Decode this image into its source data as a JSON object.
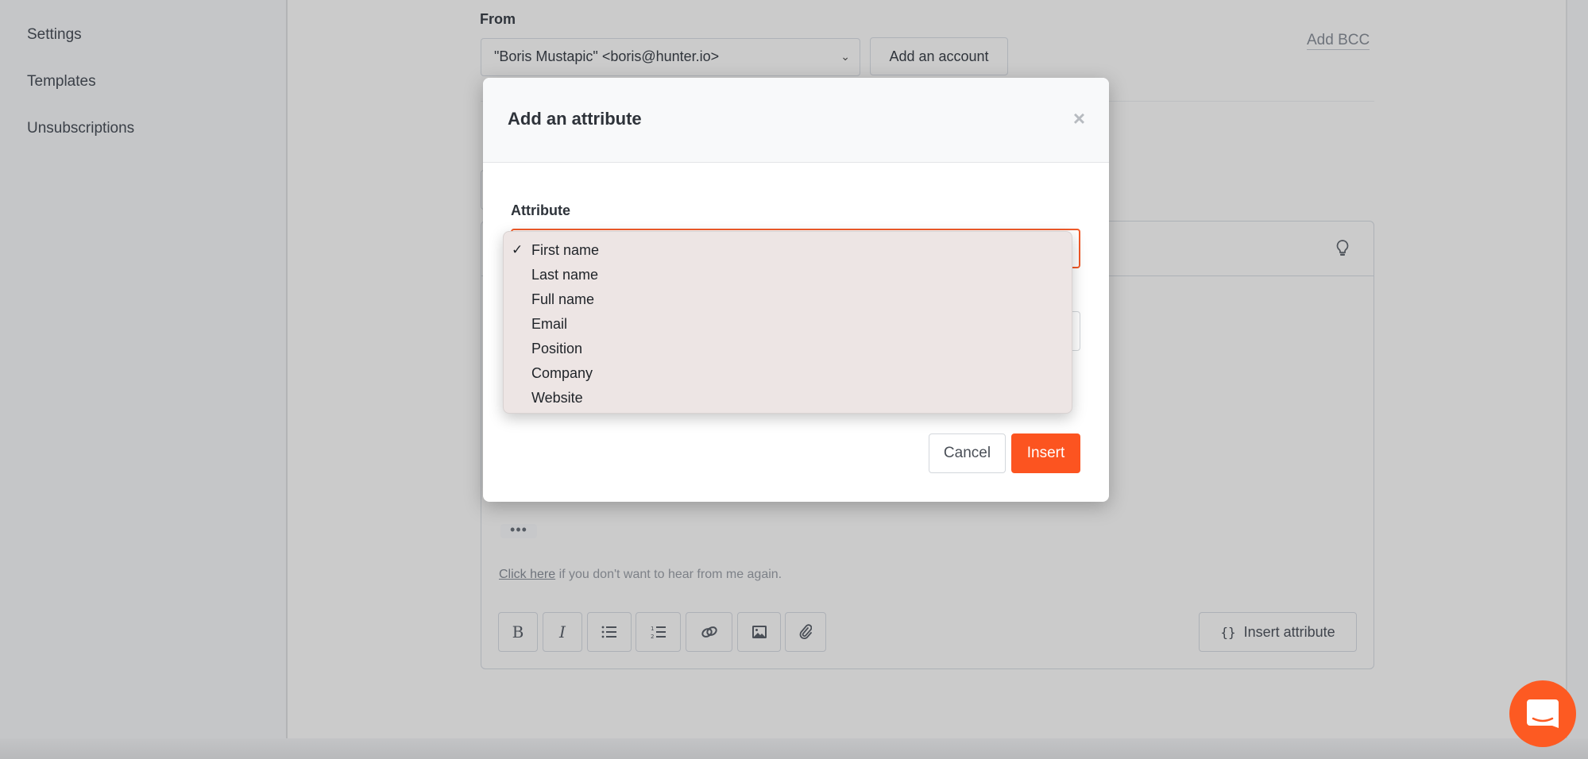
{
  "sidebar": {
    "items": [
      {
        "label": "Settings"
      },
      {
        "label": "Templates"
      },
      {
        "label": "Unsubscriptions"
      }
    ]
  },
  "compose": {
    "from_label": "From",
    "from_value": "\"Boris Mustapic\" <boris@hunter.io>",
    "add_account_label": "Add an account",
    "add_bcc_label": "Add BCC",
    "ellipsis": "•••",
    "unsubscribe_link": "Click here",
    "unsubscribe_text": " if you don't want to hear from me again.",
    "toolbar": {
      "bold": "B",
      "italic": "I",
      "insert_attribute_icon": "{}",
      "insert_attribute_label": "Insert attribute"
    }
  },
  "modal": {
    "title": "Add an attribute",
    "close_icon": "×",
    "field_label": "Attribute",
    "selected_value": "First name",
    "options": [
      {
        "label": "First name",
        "selected": true
      },
      {
        "label": "Last name",
        "selected": false
      },
      {
        "label": "Full name",
        "selected": false
      },
      {
        "label": "Email",
        "selected": false
      },
      {
        "label": "Position",
        "selected": false
      },
      {
        "label": "Company",
        "selected": false
      },
      {
        "label": "Website",
        "selected": false
      }
    ],
    "check_glyph": "✓",
    "cancel_label": "Cancel",
    "insert_label": "Insert"
  },
  "colors": {
    "accent": "#fc5420",
    "overlay_bg": "#cbcbcb",
    "dropdown_bg": "#ede5e4"
  }
}
